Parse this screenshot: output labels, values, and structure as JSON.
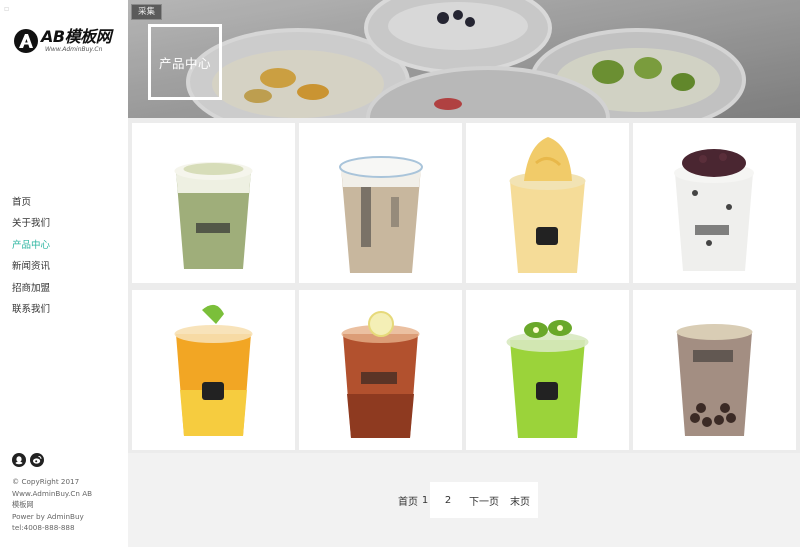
{
  "brand": {
    "logo_text": "AB模板网",
    "logo_sub": "Www.AdminBuy.Cn"
  },
  "nav": {
    "items": [
      {
        "label": "首页"
      },
      {
        "label": "关于我们"
      },
      {
        "label": "产品中心",
        "active": true
      },
      {
        "label": "新闻资讯"
      },
      {
        "label": "招商加盟"
      },
      {
        "label": "联系我们"
      }
    ]
  },
  "banner": {
    "tag": "采集",
    "title": "产品中心"
  },
  "products": [
    {
      "name": "matcha-milk-tea"
    },
    {
      "name": "cheese-milk-tea"
    },
    {
      "name": "mango-smoothie"
    },
    {
      "name": "red-bean-milk"
    },
    {
      "name": "orange-lime-tea"
    },
    {
      "name": "lemon-black-tea"
    },
    {
      "name": "kiwi-green-tea"
    },
    {
      "name": "pearl-milk-tea"
    }
  ],
  "pagination": {
    "first": "首页",
    "current": "1",
    "page2": "2",
    "next": "下一页",
    "last": "末页"
  },
  "footer": {
    "line1": "© CopyRight 2017",
    "line2": "Www.AdminBuy.Cn AB",
    "line3": "模板网",
    "line4": "Power by AdminBuy",
    "line5": "tel:4008-888-888"
  },
  "colors": {
    "accent": "#2bb5a0",
    "banner_overlay": "#9b9b9b",
    "page_bg": "#f2f2f2"
  },
  "icons": {
    "social": [
      "qq-icon",
      "weibo-icon"
    ]
  }
}
